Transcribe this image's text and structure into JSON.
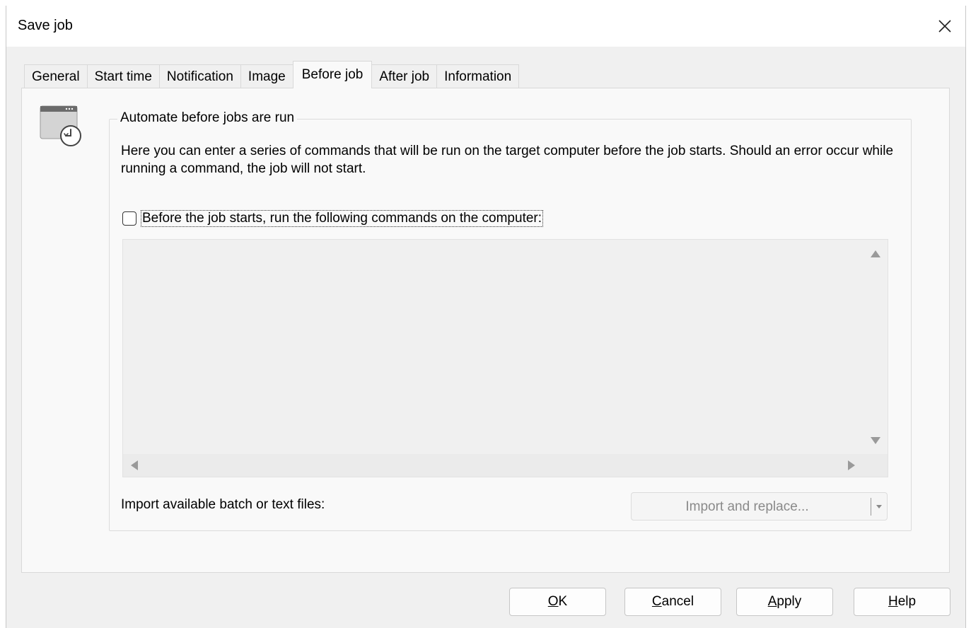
{
  "window": {
    "title": "Save job"
  },
  "tabs": [
    {
      "label": "General",
      "active": false
    },
    {
      "label": "Start time",
      "active": false
    },
    {
      "label": "Notification",
      "active": false
    },
    {
      "label": "Image",
      "active": false
    },
    {
      "label": "Before job",
      "active": true
    },
    {
      "label": "After job",
      "active": false
    },
    {
      "label": "Information",
      "active": false
    }
  ],
  "panel": {
    "icon": "clock-window-icon",
    "group_title": "Automate before jobs are run",
    "description": "Here you can enter a series of commands that will be run on the target computer before the job starts. Should an error occur while running a command, the job will not start.",
    "checkbox": {
      "label": "Before the job starts, run the following commands on the computer:",
      "checked": false
    },
    "commands_text": "",
    "import": {
      "label": "Import available batch or text files:",
      "button_label": "Import and replace...",
      "enabled": false
    }
  },
  "buttons": {
    "ok": {
      "mnemonic": "O",
      "rest": "K"
    },
    "cancel": {
      "mnemonic": "C",
      "rest": "ancel"
    },
    "apply": {
      "mnemonic": "A",
      "rest": "pply"
    },
    "help": {
      "mnemonic": "H",
      "rest": "elp"
    }
  },
  "colors": {
    "dialog_bg": "#f0f0f0",
    "panel_bg": "#f9f9f9",
    "disabled_text": "#8a8a8a"
  }
}
